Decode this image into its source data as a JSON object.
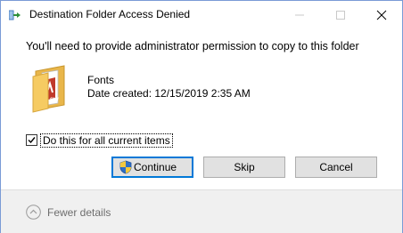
{
  "window": {
    "title": "Destination Folder Access Denied"
  },
  "message": "You'll need to provide administrator permission to copy to this folder",
  "item": {
    "name": "Fonts",
    "date_created": "Date created: 12/15/2019 2:35 AM"
  },
  "checkbox": {
    "label": "Do this for all current items",
    "checked": true
  },
  "buttons": {
    "continue": "Continue",
    "skip": "Skip",
    "cancel": "Cancel"
  },
  "footer": {
    "details_label": "Fewer details"
  },
  "colors": {
    "accent": "#0078d7",
    "button_bg": "#e1e1e1",
    "footer_bg": "#f0f0f0"
  }
}
